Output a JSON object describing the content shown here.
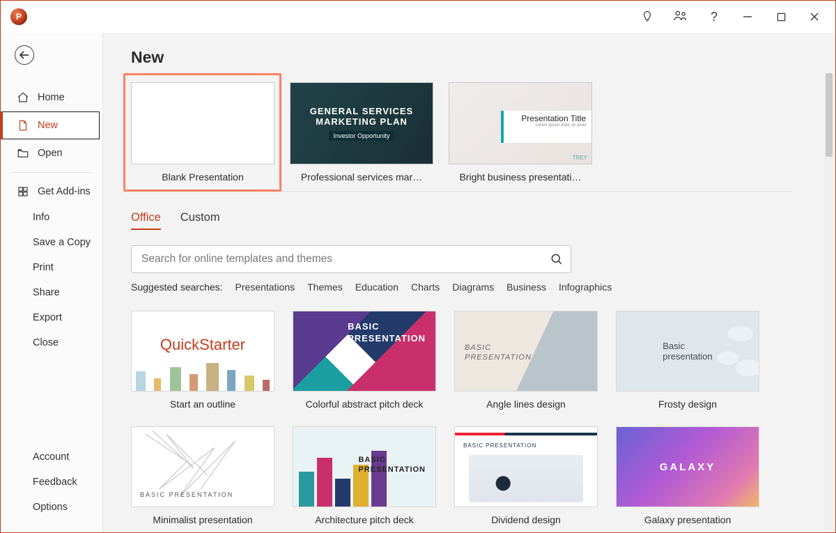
{
  "app": {
    "title_letter": "P"
  },
  "sidebar": {
    "home": "Home",
    "new": "New",
    "open": "Open",
    "addins": "Get Add-ins",
    "info": "Info",
    "save_copy": "Save a Copy",
    "print": "Print",
    "share": "Share",
    "export": "Export",
    "close": "Close",
    "account": "Account",
    "feedback": "Feedback",
    "options": "Options"
  },
  "page_title": "New",
  "featured": [
    {
      "label": "Blank Presentation"
    },
    {
      "label": "Professional services mar…",
      "line1": "GENERAL SERVICES",
      "line2": "MARKETING PLAN",
      "badge": "Investor Opportunity"
    },
    {
      "label": "Bright business presentati…",
      "title": "Presentation Title",
      "brand": "TREY"
    }
  ],
  "tabs": {
    "office": "Office",
    "custom": "Custom"
  },
  "search": {
    "placeholder": "Search for online templates and themes"
  },
  "suggest": {
    "label": "Suggested searches:",
    "items": [
      "Presentations",
      "Themes",
      "Education",
      "Charts",
      "Diagrams",
      "Business",
      "Infographics"
    ]
  },
  "grid": {
    "rows": [
      [
        {
          "label": "Start an outline",
          "kind": "qs",
          "title": "QuickStarter"
        },
        {
          "label": "Colorful abstract pitch deck",
          "kind": "colorful",
          "t1": "BASIC",
          "t2": "PRESENTATION"
        },
        {
          "label": "Angle lines design",
          "kind": "angle",
          "t1": "BASIC",
          "t2": "PRESENTATION"
        },
        {
          "label": "Frosty design",
          "kind": "frosty",
          "t1": "Basic",
          "t2": "presentation"
        }
      ],
      [
        {
          "label": "Minimalist presentation",
          "kind": "min",
          "caption": "BASIC PRESENTATION"
        },
        {
          "label": "Architecture pitch deck",
          "kind": "arch",
          "t1": "BASIC",
          "t2": "PRESENTATION"
        },
        {
          "label": "Dividend design",
          "kind": "div",
          "caption": "BASIC PRESENTATION"
        },
        {
          "label": "Galaxy presentation",
          "kind": "galaxy",
          "caption": "GALAXY"
        }
      ]
    ]
  }
}
